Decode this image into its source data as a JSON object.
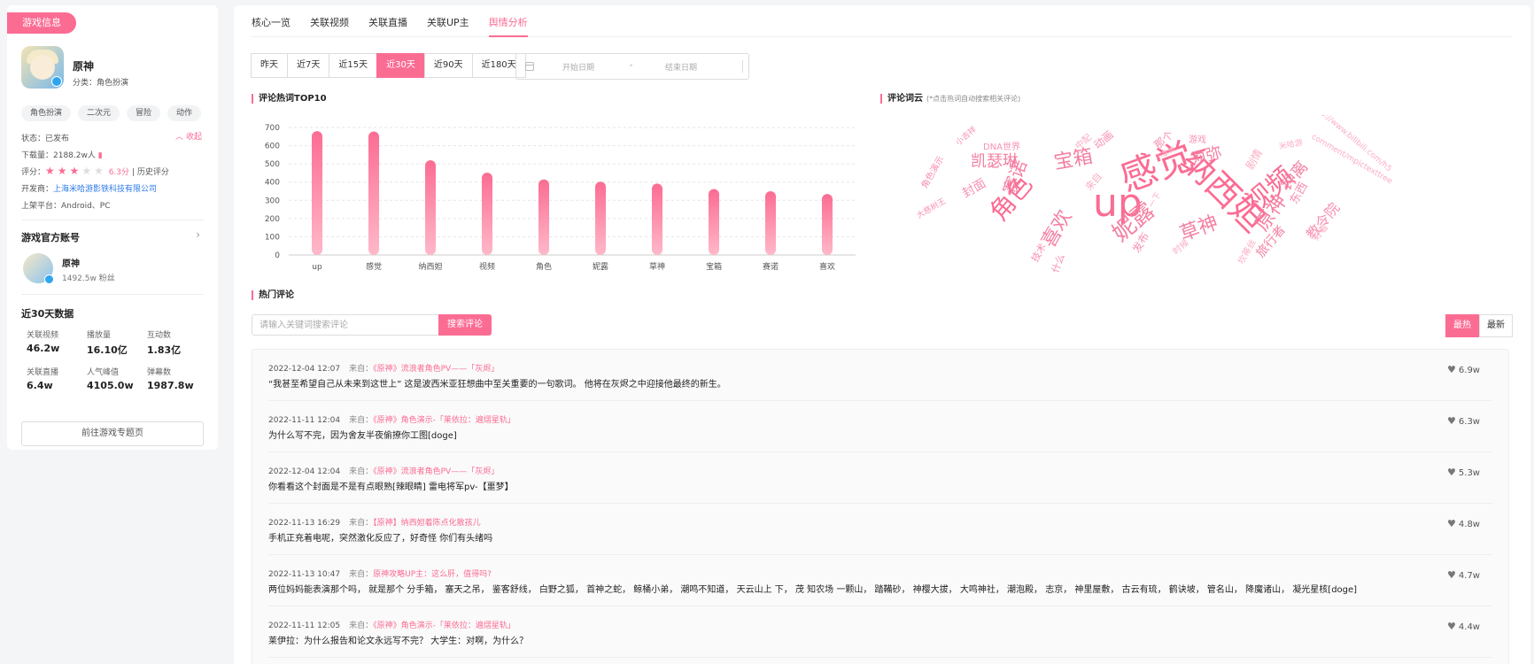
{
  "sidebar": {
    "tag": "游戏信息",
    "game": {
      "name": "原神",
      "category": "分类：角色扮演",
      "tags": [
        "角色扮演",
        "二次元",
        "冒险",
        "动作"
      ],
      "collapse": "收起",
      "status": "状态：已发布",
      "downloads": "下载量：2188.2w人",
      "rating_label": "评分：",
      "rating_stars": 3,
      "rating_max": 5,
      "rating_score": "6.3分",
      "rating_history": "| 历史评分",
      "developer_label": "开发商：",
      "developer": "上海米哈游影铁科技有限公司",
      "platforms": "上架平台：Android、PC"
    },
    "account": {
      "title": "游戏官方账号",
      "name": "原神",
      "fans": "1492.5w 粉丝"
    },
    "stats": {
      "title": "近30天数据",
      "items": [
        {
          "label": "关联视频",
          "value": "46.2w"
        },
        {
          "label": "播放量",
          "value": "16.10亿"
        },
        {
          "label": "互动数",
          "value": "1.83亿"
        },
        {
          "label": "关联直播",
          "value": "6.4w"
        },
        {
          "label": "人气峰值",
          "value": "4105.0w"
        },
        {
          "label": "弹幕数",
          "value": "1987.8w"
        }
      ]
    },
    "goto_button": "前往游戏专题页"
  },
  "tabs": [
    "核心一览",
    "关联视频",
    "关联直播",
    "关联UP主",
    "舆情分析"
  ],
  "active_tab": 4,
  "ranges": [
    "昨天",
    "近7天",
    "近15天",
    "近30天",
    "近90天",
    "近180天"
  ],
  "active_range": 3,
  "date_picker": {
    "start": "开始日期",
    "sep": "-",
    "end": "结束日期"
  },
  "hot_words": {
    "title": "评论热词TOP10"
  },
  "chart_data": {
    "type": "bar",
    "title": "评论热词TOP10",
    "categories": [
      "up",
      "感觉",
      "纳西妲",
      "视频",
      "角色",
      "妮露",
      "草神",
      "宝箱",
      "赛诺",
      "喜欢"
    ],
    "values": [
      680,
      678,
      520,
      452,
      415,
      402,
      392,
      362,
      350,
      335
    ],
    "ylim": [
      0,
      700
    ],
    "yticks": [
      0,
      100,
      200,
      300,
      400,
      500,
      600,
      700
    ],
    "grid": true,
    "bar_color": "#fb6c93"
  },
  "word_cloud": {
    "title": "评论词云",
    "hint": "(*点击热词自动搜索相关评论)",
    "words": [
      "感觉",
      "up",
      "纳西妲",
      "视频",
      "角色",
      "宝箱",
      "妮露",
      "草神",
      "原神",
      "须弥",
      "喜欢",
      "赛诺",
      "凯瑟琳",
      "钟离",
      "旅行者",
      "教令院",
      "东西",
      "动画",
      "那个",
      "游戏",
      "技术",
      "发布",
      "什么",
      "角色演示",
      "封面",
      "大慈树王",
      "DNA世界",
      "小吉祥",
      "中配",
      "米哈游",
      "剧情",
      "来自",
      "坎蒂丝",
      "时候",
      "https://www.bilibili.com/h5",
      "comment/mpictexttree",
      "小草神",
      "一下",
      "好看"
    ]
  },
  "comments_section": {
    "title": "热门评论",
    "search_placeholder": "请输入关键词搜索评论",
    "search_button": "搜索评论",
    "sort": [
      "最热",
      "最新"
    ],
    "active_sort": 0,
    "items": [
      {
        "time": "2022-12-04 12:07",
        "from": "来自：",
        "source": "《原神》流浪者角色PV——「灰烬」",
        "text": "“我甚至希望自己从未来到这世上” 这是波西米亚狂想曲中至关重要的一句歌词。 他将在灰烬之中迎接他最终的新生。",
        "likes": "6.9w"
      },
      {
        "time": "2022-11-11 12:04",
        "from": "来自：",
        "source": "《原神》角色演示-「莱依拉：遍熠星轨」",
        "text": "为什么写不完，因为舍友半夜偷撩你工图[doge]",
        "likes": "6.3w"
      },
      {
        "time": "2022-12-04 12:04",
        "from": "来自：",
        "source": "《原神》流浪者角色PV——「灰烬」",
        "text": "你看看这个封面是不是有点眼熟[辣眼睛] 雷电将军pv-【噩梦】",
        "likes": "5.3w"
      },
      {
        "time": "2022-11-13 16:29",
        "from": "来自：",
        "source": "【原神】纳西妲着陈点化散孩儿",
        "text": "手机正充着电呢，突然激化反应了，好奇怪 你们有头绪吗",
        "likes": "4.8w"
      },
      {
        "time": "2022-11-13 10:47",
        "from": "来自：",
        "source": "原神攻略UP主：这么肝，值得吗?",
        "text": "两位妈妈能表演那个吗， 就是那个 分手箱， 塞天之吊， 鉴客舒线， 白野之狐， 首神之蛇， 鲸桶小弟， 潮鸣不知道， 天云山上 下，  茂 知农场 一颗山， 踏鞴砂， 神樱大拔， 大鸣神社， 潮泡殿， 志京， 神里屋敷， 古云有琉， 鹤诀坡， 管名山， 降魔诸山， 凝光星核[doge]",
        "likes": "4.7w"
      },
      {
        "time": "2022-11-11 12:05",
        "from": "来自：",
        "source": "《原神》角色演示-「莱依拉：遍熠星轨」",
        "text": "莱伊拉：为什么报告和论文永远写不完？ 大学生：对啊，为什么？",
        "likes": "4.4w"
      }
    ]
  },
  "colors": {
    "accent": "#fb6c93",
    "link": "#2e7be6"
  }
}
